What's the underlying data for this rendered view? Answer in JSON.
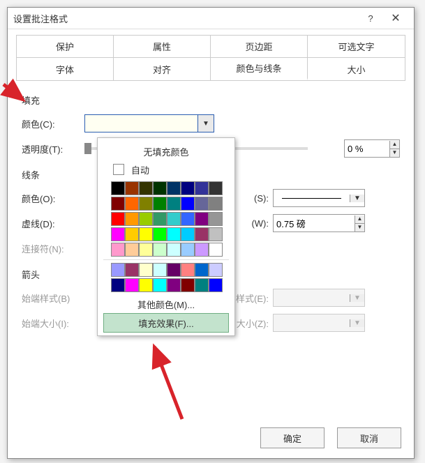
{
  "window": {
    "title": "设置批注格式",
    "help": "?",
    "close": "✕"
  },
  "tabs": {
    "r1": [
      "保护",
      "属性",
      "页边距",
      "可选文字"
    ],
    "r2": [
      "字体",
      "对齐",
      "颜色与线条",
      "大小"
    ],
    "active": "颜色与线条"
  },
  "fill": {
    "section": "填充",
    "color_label": "颜色(C):",
    "trans_label": "透明度(T):",
    "trans_value": "0 %"
  },
  "line": {
    "section": "线条",
    "color_label": "颜色(O):",
    "dash_label": "虚线(D):",
    "connector_label": "连接符(N):",
    "style_label": "(S):",
    "weight_label": "(W):",
    "weight_value": "0.75 磅"
  },
  "arrows": {
    "section": "箭头",
    "begin_style": "始端样式(B)",
    "begin_size": "始端大小(I):",
    "end_style": "样式(E):",
    "end_size": "大小(Z):"
  },
  "picker": {
    "nofill": "无填充颜色",
    "auto": "自动",
    "more": "其他颜色(M)...",
    "effects": "填充效果(F)...",
    "palette1": [
      "#000000",
      "#993300",
      "#333300",
      "#003300",
      "#003366",
      "#000080",
      "#333399",
      "#333333",
      "#800000",
      "#ff6600",
      "#808000",
      "#008000",
      "#008080",
      "#0000ff",
      "#666699",
      "#808080",
      "#ff0000",
      "#ff9900",
      "#99cc00",
      "#339966",
      "#33cccc",
      "#3366ff",
      "#800080",
      "#969696",
      "#ff00ff",
      "#ffcc00",
      "#ffff00",
      "#00ff00",
      "#00ffff",
      "#00ccff",
      "#993366",
      "#c0c0c0",
      "#ff99cc",
      "#ffcc99",
      "#ffff99",
      "#ccffcc",
      "#ccffff",
      "#99ccff",
      "#cc99ff",
      "#ffffff"
    ],
    "palette2": [
      "#9999ff",
      "#993366",
      "#ffffcc",
      "#ccffff",
      "#660066",
      "#ff8080",
      "#0066cc",
      "#ccccff",
      "#000080",
      "#ff00ff",
      "#ffff00",
      "#00ffff",
      "#800080",
      "#800000",
      "#008080",
      "#0000ff"
    ]
  },
  "buttons": {
    "ok": "确定",
    "cancel": "取消"
  }
}
